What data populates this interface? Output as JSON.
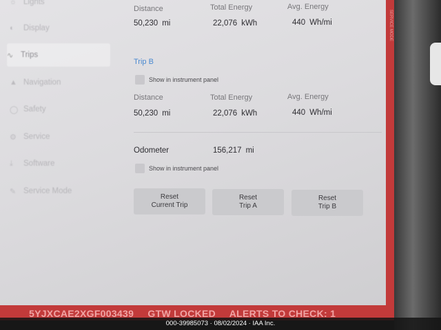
{
  "sidebar": {
    "items": [
      {
        "label": "Lights",
        "icon": "lights-icon"
      },
      {
        "label": "Display",
        "icon": "display-icon"
      },
      {
        "label": "Trips",
        "icon": "trips-icon",
        "active": true
      },
      {
        "label": "Navigation",
        "icon": "navigation-icon"
      },
      {
        "label": "Safety",
        "icon": "safety-icon"
      },
      {
        "label": "Service",
        "icon": "service-icon"
      },
      {
        "label": "Software",
        "icon": "software-icon"
      },
      {
        "label": "Service Mode",
        "icon": "wrench-icon"
      }
    ]
  },
  "trip_a": {
    "distance_label": "Distance",
    "energy_label": "Total Energy",
    "avg_label": "Avg. Energy",
    "distance": "50,230",
    "distance_unit": "mi",
    "energy": "22,076",
    "energy_unit": "kWh",
    "avg": "440",
    "avg_unit": "Wh/mi"
  },
  "trip_b": {
    "title": "Trip B",
    "show_label": "Show in instrument panel",
    "distance_label": "Distance",
    "energy_label": "Total Energy",
    "avg_label": "Avg. Energy",
    "distance": "50,230",
    "distance_unit": "mi",
    "energy": "22,076",
    "energy_unit": "kWh",
    "avg": "440",
    "avg_unit": "Wh/mi"
  },
  "odometer": {
    "label": "Odometer",
    "value": "156,217",
    "unit": "mi",
    "show_label": "Show in instrument panel"
  },
  "buttons": {
    "reset_current": "Reset\nCurrent Trip",
    "reset_a": "Reset\nTrip A",
    "reset_b": "Reset\nTrip B"
  },
  "banner": {
    "vin": "5YJXCAE2XGF003439",
    "gtw": "GTW LOCKED",
    "alerts": "ALERTS TO CHECK: 1"
  },
  "vertical_label": "SERVICE MODE",
  "caption": "000-39985073 · 08/02/2024 · IAA Inc."
}
